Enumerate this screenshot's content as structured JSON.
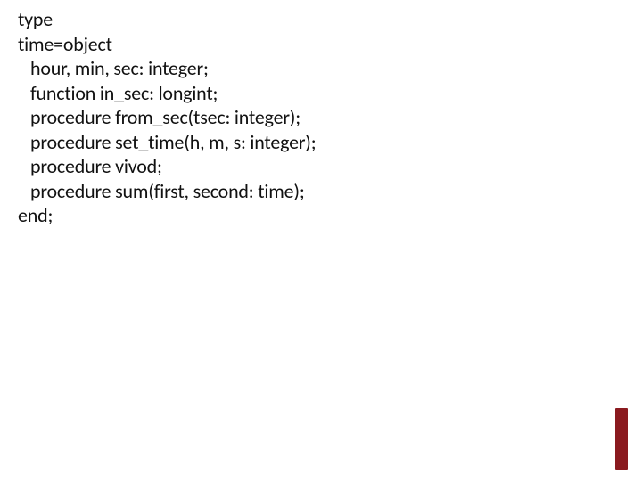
{
  "code": {
    "l1": "type",
    "l2": "time=object",
    "l3": "hour, min, sec: integer;",
    "l4": "function in_sec: longint;",
    "l5": "procedure from_sec(tsec: integer);",
    "l6": "procedure set_time(h, m, s: integer);",
    "l7": "procedure vivod;",
    "l8": "procedure sum(first, second: time);",
    "l9": "end;"
  }
}
